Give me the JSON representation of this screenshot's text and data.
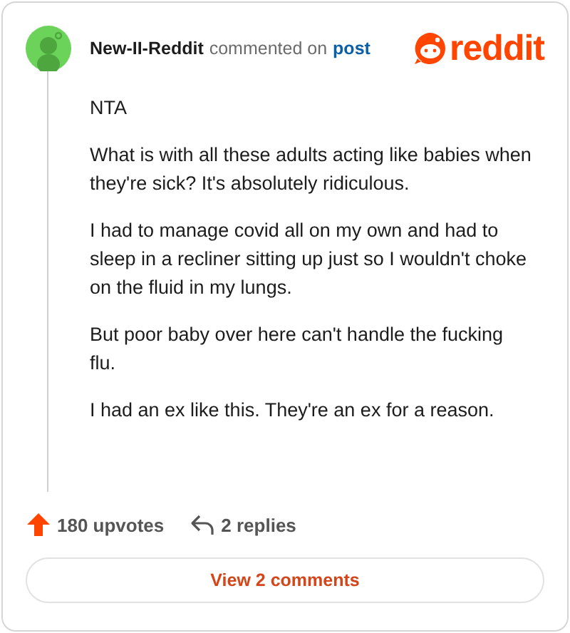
{
  "header": {
    "author": "New-II-Reddit",
    "action": "commented on",
    "link": "post",
    "logo": "reddit"
  },
  "comment": {
    "paragraphs": [
      "NTA",
      "What is with all these adults acting like babies when they're sick? It's absolutely ridiculous.",
      "I had to manage covid all on my own and had to sleep in a recliner sitting up just so I wouldn't choke on the fluid in my lungs.",
      "But poor baby over here can't handle the fucking flu.",
      "I had an ex like this. They're an ex for a reason."
    ]
  },
  "footer": {
    "upvotes": "180 upvotes",
    "replies": "2 replies"
  },
  "button": "View 2 comments"
}
